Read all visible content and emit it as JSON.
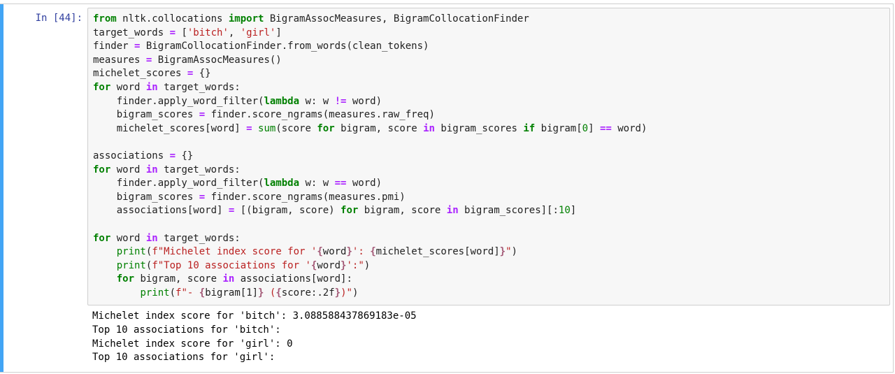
{
  "cell": {
    "prompt": "In [44]:",
    "code_lines": [
      [
        {
          "t": "from",
          "c": "k"
        },
        {
          "t": " nltk.collocations "
        },
        {
          "t": "import",
          "c": "k"
        },
        {
          "t": " BigramAssocMeasures, BigramCollocationFinder"
        }
      ],
      [
        {
          "t": "target_words "
        },
        {
          "t": "=",
          "c": "o"
        },
        {
          "t": " ["
        },
        {
          "t": "'bitch'",
          "c": "s"
        },
        {
          "t": ", "
        },
        {
          "t": "'girl'",
          "c": "s"
        },
        {
          "t": "]"
        }
      ],
      [
        {
          "t": "finder "
        },
        {
          "t": "=",
          "c": "o"
        },
        {
          "t": " BigramCollocationFinder.from_words(clean_tokens)"
        }
      ],
      [
        {
          "t": "measures "
        },
        {
          "t": "=",
          "c": "o"
        },
        {
          "t": " BigramAssocMeasures()"
        }
      ],
      [
        {
          "t": "michelet_scores "
        },
        {
          "t": "=",
          "c": "o"
        },
        {
          "t": " {}"
        }
      ],
      [
        {
          "t": "for",
          "c": "k"
        },
        {
          "t": " word "
        },
        {
          "t": "in",
          "c": "o"
        },
        {
          "t": " target_words:"
        }
      ],
      [
        {
          "t": "    finder.apply_word_filter("
        },
        {
          "t": "lambda",
          "c": "k"
        },
        {
          "t": " w: w "
        },
        {
          "t": "!=",
          "c": "o"
        },
        {
          "t": " word)"
        }
      ],
      [
        {
          "t": "    bigram_scores "
        },
        {
          "t": "=",
          "c": "o"
        },
        {
          "t": " finder.score_ngrams(measures.raw_freq)"
        }
      ],
      [
        {
          "t": "    michelet_scores[word] "
        },
        {
          "t": "=",
          "c": "o"
        },
        {
          "t": " "
        },
        {
          "t": "sum",
          "c": "b"
        },
        {
          "t": "(score "
        },
        {
          "t": "for",
          "c": "k"
        },
        {
          "t": " bigram, score "
        },
        {
          "t": "in",
          "c": "o"
        },
        {
          "t": " bigram_scores "
        },
        {
          "t": "if",
          "c": "k"
        },
        {
          "t": " bigram["
        },
        {
          "t": "0",
          "c": "n"
        },
        {
          "t": "] "
        },
        {
          "t": "==",
          "c": "o"
        },
        {
          "t": " word)"
        }
      ],
      [],
      [
        {
          "t": "associations "
        },
        {
          "t": "=",
          "c": "o"
        },
        {
          "t": " {}"
        }
      ],
      [
        {
          "t": "for",
          "c": "k"
        },
        {
          "t": " word "
        },
        {
          "t": "in",
          "c": "o"
        },
        {
          "t": " target_words:"
        }
      ],
      [
        {
          "t": "    finder.apply_word_filter("
        },
        {
          "t": "lambda",
          "c": "k"
        },
        {
          "t": " w: w "
        },
        {
          "t": "==",
          "c": "o"
        },
        {
          "t": " word)"
        }
      ],
      [
        {
          "t": "    bigram_scores "
        },
        {
          "t": "=",
          "c": "o"
        },
        {
          "t": " finder.score_ngrams(measures.pmi)"
        }
      ],
      [
        {
          "t": "    associations[word] "
        },
        {
          "t": "=",
          "c": "o"
        },
        {
          "t": " [(bigram, score) "
        },
        {
          "t": "for",
          "c": "k"
        },
        {
          "t": " bigram, score "
        },
        {
          "t": "in",
          "c": "o"
        },
        {
          "t": " bigram_scores][:"
        },
        {
          "t": "10",
          "c": "n"
        },
        {
          "t": "]"
        }
      ],
      [],
      [
        {
          "t": "for",
          "c": "k"
        },
        {
          "t": " word "
        },
        {
          "t": "in",
          "c": "o"
        },
        {
          "t": " target_words:"
        }
      ],
      [
        {
          "t": "    "
        },
        {
          "t": "print",
          "c": "b"
        },
        {
          "t": "("
        },
        {
          "t": "f\"Michelet index score for '",
          "c": "s"
        },
        {
          "t": "{",
          "c": "si"
        },
        {
          "t": "word"
        },
        {
          "t": "}",
          "c": "si"
        },
        {
          "t": "': ",
          "c": "s"
        },
        {
          "t": "{",
          "c": "si"
        },
        {
          "t": "michelet_scores[word]"
        },
        {
          "t": "}",
          "c": "si"
        },
        {
          "t": "\"",
          "c": "s"
        },
        {
          "t": ")"
        }
      ],
      [
        {
          "t": "    "
        },
        {
          "t": "print",
          "c": "b"
        },
        {
          "t": "("
        },
        {
          "t": "f\"Top 10 associations for '",
          "c": "s"
        },
        {
          "t": "{",
          "c": "si"
        },
        {
          "t": "word"
        },
        {
          "t": "}",
          "c": "si"
        },
        {
          "t": "':\"",
          "c": "s"
        },
        {
          "t": ")"
        }
      ],
      [
        {
          "t": "    "
        },
        {
          "t": "for",
          "c": "k"
        },
        {
          "t": " bigram, score "
        },
        {
          "t": "in",
          "c": "o"
        },
        {
          "t": " associations[word]:"
        }
      ],
      [
        {
          "t": "        "
        },
        {
          "t": "print",
          "c": "b"
        },
        {
          "t": "("
        },
        {
          "t": "f\"- ",
          "c": "s"
        },
        {
          "t": "{",
          "c": "si"
        },
        {
          "t": "bigram[1]"
        },
        {
          "t": "}",
          "c": "si"
        },
        {
          "t": " (",
          "c": "s"
        },
        {
          "t": "{",
          "c": "si"
        },
        {
          "t": "score:.2f"
        },
        {
          "t": "}",
          "c": "si"
        },
        {
          "t": ")\"",
          "c": "s"
        },
        {
          "t": ")"
        }
      ]
    ],
    "output_lines": [
      "Michelet index score for 'bitch': 3.088588437869183e-05",
      "Top 10 associations for 'bitch':",
      "Michelet index score for 'girl': 0",
      "Top 10 associations for 'girl':"
    ]
  },
  "colors": {
    "selected_bar": "#42a5f5",
    "prompt": "#303f9f",
    "keyword": "#008000",
    "operator": "#aa22ff",
    "string": "#ba2121"
  }
}
